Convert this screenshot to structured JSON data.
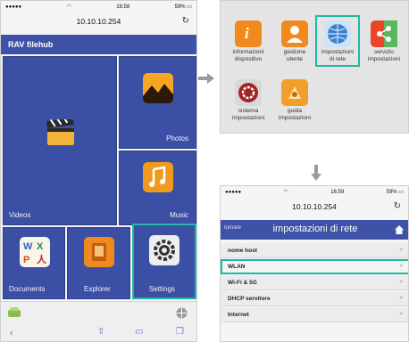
{
  "phone1": {
    "status_time": "16:58",
    "status_battery": "59%",
    "url": "10.10.10.254",
    "app_title": "RAV filehub",
    "tiles": {
      "videos": "Videos",
      "photos": "Photos",
      "music": "Music",
      "documents": "Documents",
      "explorer": "Explorer",
      "settings": "Settings"
    }
  },
  "settings_panel": {
    "items": [
      {
        "label": "informazioni\ndispositivo",
        "icon": "info-icon",
        "color": "#f08a1c"
      },
      {
        "label": "gestione\nutente",
        "icon": "user-icon",
        "color": "#f08a1c"
      },
      {
        "label": "impostazioni\ndi rete",
        "icon": "globe-network-icon",
        "color": "#4a8fd6"
      },
      {
        "label": "servizio\nimpostazioni",
        "icon": "share-icon",
        "color": "#e8452b"
      },
      {
        "label": "sistema\nimpostazioni",
        "icon": "system-gear-icon",
        "color": "#a32424"
      },
      {
        "label": "guida\nimpostazioni",
        "icon": "guide-icon",
        "color": "#f0a02a"
      }
    ]
  },
  "phone2": {
    "status_time": "16:59",
    "status_battery": "59%",
    "url": "10.10.10.254",
    "back_label": "tornare",
    "title": "impostazioni di rete",
    "rows": [
      "nome host",
      "WLAN",
      "Wi-Fi & 5G",
      "DHCP servitore",
      "Internet"
    ]
  },
  "colors": {
    "accent": "#20b8a2",
    "tile_blue": "#3b4fa5",
    "header_blue": "#3e52a8"
  }
}
